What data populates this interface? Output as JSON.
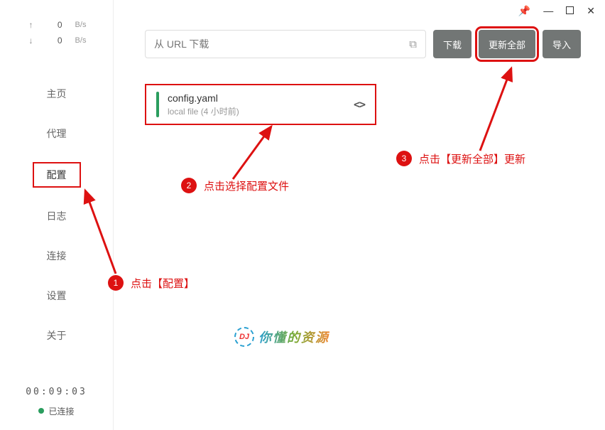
{
  "titlebar": {
    "pin": "📌",
    "min": "—",
    "close": "✕"
  },
  "speed": {
    "up_arrow": "↑",
    "up_val": "0",
    "down_arrow": "↓",
    "down_val": "0",
    "unit": "B/s"
  },
  "nav": {
    "home": "主页",
    "proxy": "代理",
    "config": "配置",
    "logs": "日志",
    "connections": "连接",
    "settings": "设置",
    "about": "关于"
  },
  "status": {
    "time": "00:09:03",
    "label": "已连接"
  },
  "toolbar": {
    "url_placeholder": "从 URL 下载",
    "paste": "⧉",
    "download": "下载",
    "update_all": "更新全部",
    "import": "导入"
  },
  "card": {
    "title": "config.yaml",
    "subtitle": "local file (4 小时前)",
    "icon": "<>"
  },
  "annotations": {
    "a1_num": "1",
    "a1_text": "点击【配置】",
    "a2_num": "2",
    "a2_text": "点击选择配置文件",
    "a3_num": "3",
    "a3_text": "点击【更新全部】更新"
  },
  "watermark": {
    "logo": "DJ",
    "text": "你懂的资源"
  }
}
